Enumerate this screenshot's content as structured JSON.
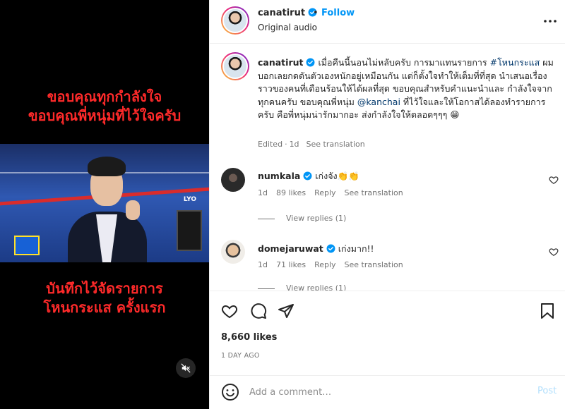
{
  "video": {
    "caption_top": [
      "ขอบคุณทุกกำลังใจ",
      "ขอบคุณพี่หนุ่มที่ไว้ใจครับ"
    ],
    "caption_bottom": [
      "บันทึกไว้จัดรายการ",
      "โหนกระแส ครั้งแรก"
    ],
    "studio_label": "LYO",
    "mute_icon": "speaker-muted-icon"
  },
  "header": {
    "username": "canatirut",
    "separator": "•",
    "follow_label": "Follow",
    "audio_label": "Original audio"
  },
  "post_caption": {
    "username": "canatirut",
    "text_1": " เมื่อคืนนี้นอนไม่หลับครับ การมาแทนรายการ ",
    "hashtag": "#โหนกระแส",
    "text_2": " ผมบอกเลยกดดันตัวเองหนักอยู่เหมือนกัน แต่ก็ตั้งใจทำให้เต็มที่ที่สุด นำเสนอเรื่องราวของคนที่เดือนร้อนให้ได้ผลที่สุด ขอบคุณสำหรับคำแนะนำและ กำลังใจจากทุกคนครับ ขอบคุณพี่หนุ่ม ",
    "mention": "@kanchai",
    "text_3": " ที่ไว้ใจและให้โอกาสได้ลองทำรายการครับ คือพี่หนุ่มน่ารักมากอะ ส่งกำลังใจให้ตลอดๆๆๆ 😁",
    "edited": "Edited",
    "dot": "·",
    "time": "1d",
    "see_translation": "See translation"
  },
  "comments": [
    {
      "username": "numkala",
      "text": "เก่งจัง👏👏",
      "time": "1d",
      "likes": "89 likes",
      "reply": "Reply",
      "see_translation": "See translation",
      "view_replies": "View replies (1)"
    },
    {
      "username": "domejaruwat",
      "text": "เก่งมาก!!",
      "time": "1d",
      "likes": "71 likes",
      "reply": "Reply",
      "see_translation": "See translation",
      "view_replies": "View replies (1)"
    }
  ],
  "actions": {
    "likes": "8,660 likes",
    "date": "1 DAY AGO"
  },
  "composer": {
    "placeholder": "Add a comment…",
    "post_label": "Post"
  },
  "colors": {
    "accent": "#0095f6",
    "caption_red": "#ff2a2a",
    "muted": "#737373",
    "post_disabled": "#b2dffc"
  }
}
